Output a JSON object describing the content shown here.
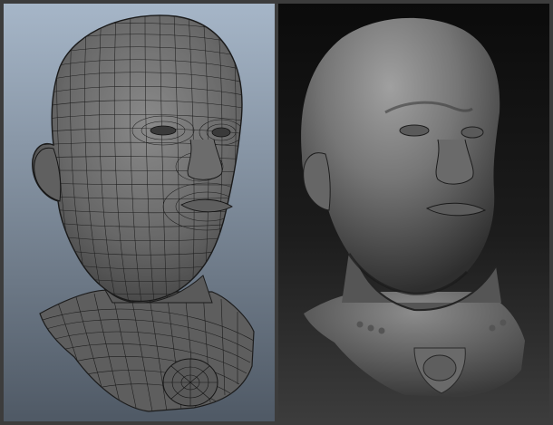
{
  "image": {
    "panels": [
      {
        "id": "wireframe",
        "subject": "head-bust-wireframe",
        "colors": {
          "bg_top": "#9fb0c2",
          "bg_bottom": "#56606b",
          "mesh_fill": "#6a6a6a",
          "mesh_line": "#1c1c1c",
          "highlight": "#8a8a8a"
        }
      },
      {
        "id": "sculpt",
        "subject": "head-bust-sculpt",
        "colors": {
          "bg_top": "#0a0a0a",
          "bg_bottom": "#3a3a3a",
          "skin_light": "#9a9a9a",
          "skin_mid": "#6e6e6e",
          "skin_dark": "#2a2a2a"
        }
      }
    ]
  }
}
